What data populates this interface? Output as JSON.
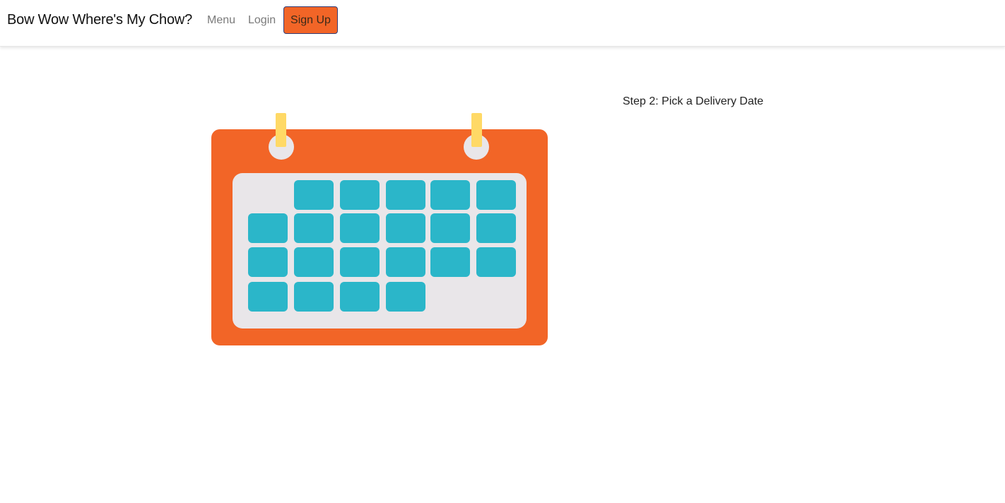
{
  "navbar": {
    "brand": "Bow Wow Where's My Chow?",
    "links": [
      {
        "label": "Menu"
      },
      {
        "label": "Login"
      }
    ],
    "signup_label": "Sign Up"
  },
  "main": {
    "step_label": "Step 2: Pick a Delivery Date"
  },
  "colors": {
    "accent_orange": "#f26527",
    "calendar_tile": "#2bb6c9",
    "calendar_panel": "#e9e6e9",
    "ring_tab": "#ffd966"
  },
  "icons": {
    "illustration": "calendar-icon"
  }
}
